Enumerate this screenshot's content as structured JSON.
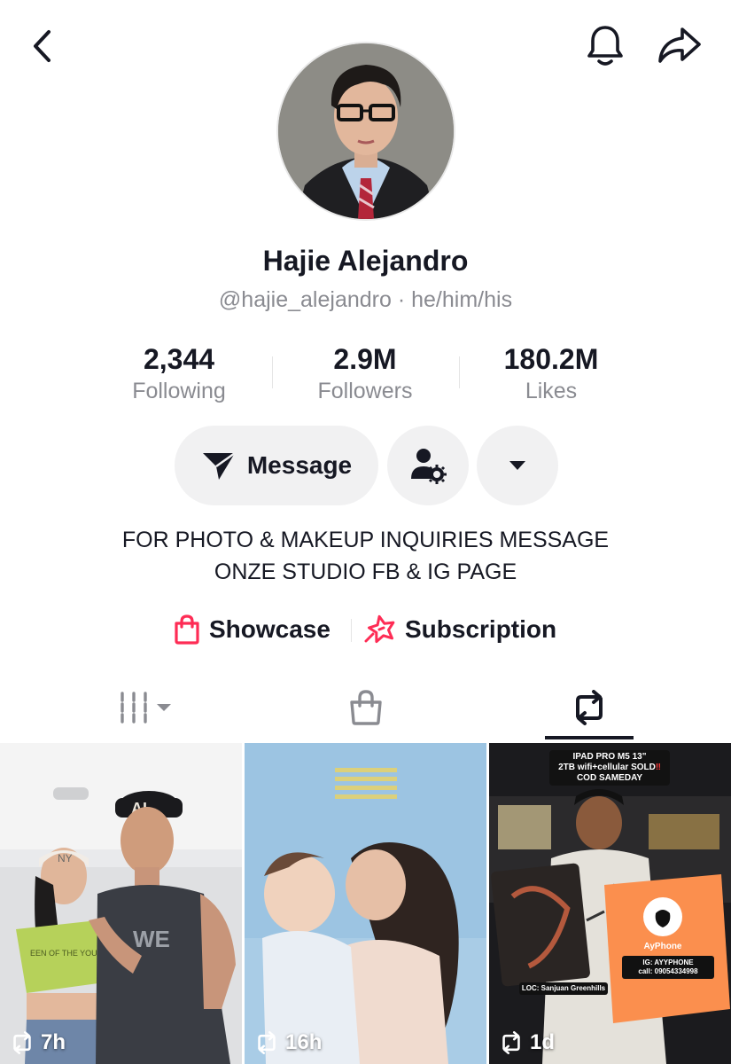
{
  "profile": {
    "name": "Hajie Alejandro",
    "handle": "@hajie_alejandro",
    "separator": "·",
    "pronouns": "he/him/his"
  },
  "stats": [
    {
      "value": "2,344",
      "label": "Following"
    },
    {
      "value": "2.9M",
      "label": "Followers"
    },
    {
      "value": "180.2M",
      "label": "Likes"
    }
  ],
  "actions": {
    "message_label": "Message",
    "person_settings_icon": "person-gear-icon",
    "more_icon": "caret-down-icon"
  },
  "bio": {
    "line1": "FOR PHOTO & MAKEUP INQUIRIES MESSAGE",
    "line2": "ONZE STUDIO FB & IG PAGE"
  },
  "links": {
    "showcase_label": "Showcase",
    "subscription_label": "Subscription"
  },
  "tabs": {
    "active": "reposts",
    "items": [
      "videos-grid",
      "shop",
      "reposts"
    ]
  },
  "videos": [
    {
      "time": "7h",
      "cap_logo": "AL",
      "cap_logo2": "NY",
      "shirt_text": "EEN OF THE YOU"
    },
    {
      "time": "16h"
    },
    {
      "time": "1d",
      "headline1": "IPAD PRO M5 13\"",
      "headline2": "2TB wifi+cellular SOLD",
      "headline2_mark": "‼",
      "headline3": "COD SAMEDAY",
      "bag_brand": "AyPhone",
      "ig_line1": "IG: AYYPHONE",
      "ig_line2": "call: 09054334998",
      "loc": "LOC: Sanjuan Greenhills"
    }
  ],
  "colors": {
    "accent": "#fe2c55",
    "text": "#161823",
    "muted": "#8a8b91",
    "button_bg": "#f1f1f2"
  }
}
